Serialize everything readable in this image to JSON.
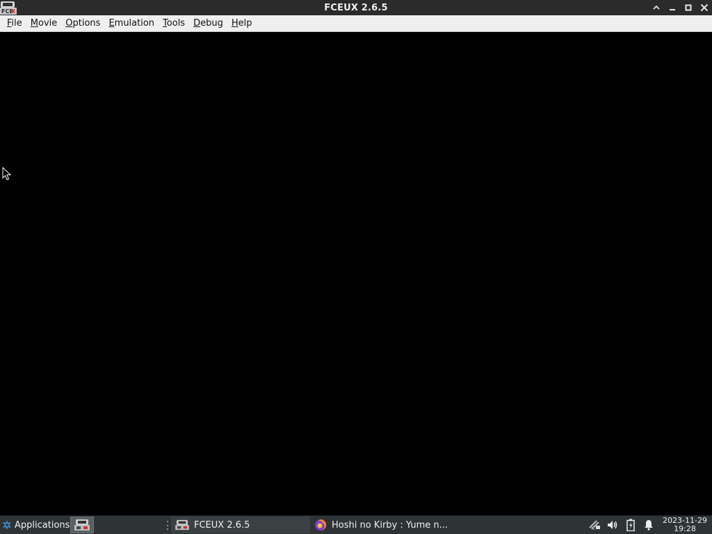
{
  "window": {
    "title": "FCEUX 2.6.5",
    "app_icon": "fceux-icon",
    "controls": [
      "maximize-up-icon",
      "minimize-icon",
      "restore-icon",
      "close-icon"
    ]
  },
  "menubar": {
    "items": [
      {
        "mnemonic": "F",
        "rest": "ile"
      },
      {
        "mnemonic": "M",
        "rest": "ovie"
      },
      {
        "mnemonic": "O",
        "rest": "ptions"
      },
      {
        "mnemonic": "E",
        "rest": "mulation"
      },
      {
        "mnemonic": "T",
        "rest": "ools"
      },
      {
        "mnemonic": "D",
        "rest": "ebug"
      },
      {
        "mnemonic": "H",
        "rest": "elp"
      }
    ]
  },
  "taskbar": {
    "applications_label": "Applications",
    "tasks": [
      {
        "label": "FCEUX 2.6.5",
        "icon": "fceux-icon"
      },
      {
        "label": "Hoshi no Kirby : Yume n...",
        "icon": "firefox-icon"
      }
    ],
    "tray": {
      "icons": [
        "network-icon",
        "volume-icon",
        "battery-icon",
        "notification-bell-icon"
      ],
      "date": "2023-11-29",
      "time": "19:28"
    }
  },
  "colors": {
    "titlebar_bg": "#2b2b2b",
    "menubar_bg": "#efefef",
    "viewport_bg": "#000000",
    "taskbar_bg": "#2e3436"
  }
}
